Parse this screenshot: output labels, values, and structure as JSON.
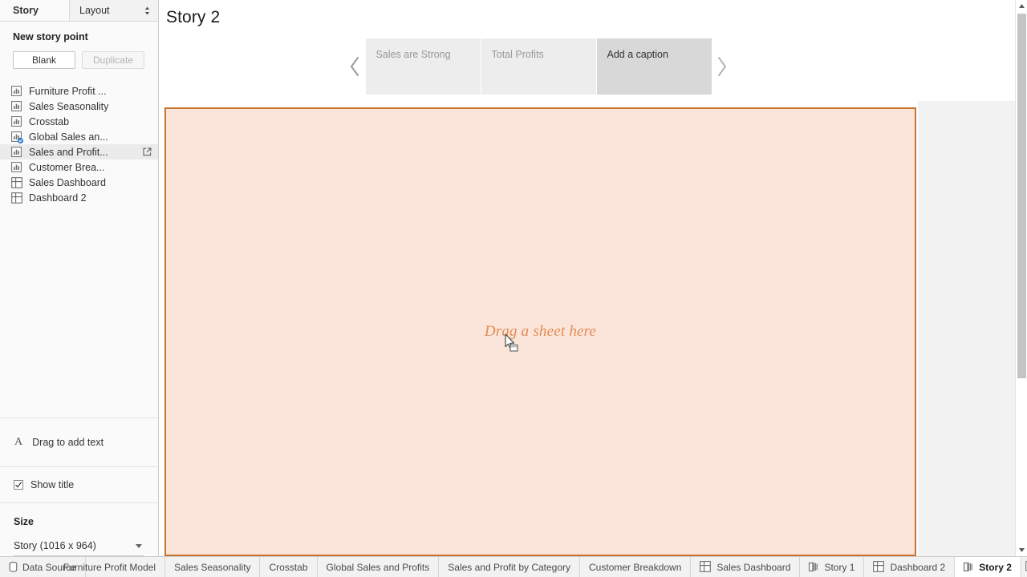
{
  "sidebar": {
    "tabs": [
      {
        "label": "Story",
        "active": true
      },
      {
        "label": "Layout",
        "active": false
      }
    ],
    "new_story_point": {
      "title": "New story point",
      "blank_label": "Blank",
      "duplicate_label": "Duplicate"
    },
    "sheets": [
      {
        "label": "Furniture Profit ...",
        "type": "worksheet",
        "used": false,
        "hovered": false
      },
      {
        "label": "Sales Seasonality",
        "type": "worksheet",
        "used": false,
        "hovered": false
      },
      {
        "label": "Crosstab",
        "type": "worksheet",
        "used": false,
        "hovered": false
      },
      {
        "label": "Global Sales an...",
        "type": "worksheet",
        "used": true,
        "hovered": false
      },
      {
        "label": "Sales and Profit...",
        "type": "worksheet",
        "used": false,
        "hovered": true
      },
      {
        "label": "Customer Brea...",
        "type": "worksheet",
        "used": false,
        "hovered": false
      },
      {
        "label": "Sales Dashboard",
        "type": "dashboard",
        "used": false,
        "hovered": false
      },
      {
        "label": "Dashboard 2",
        "type": "dashboard",
        "used": false,
        "hovered": false
      }
    ],
    "drag_text": {
      "label": "Drag to add text",
      "glyph": "A"
    },
    "show_title": {
      "label": "Show title",
      "checked": true
    },
    "size": {
      "title": "Size",
      "value": "Story (1016 x 964)"
    }
  },
  "main": {
    "story_title": "Story 2",
    "navigator": {
      "prev_icon": "chevron-left-icon",
      "next_icon": "chevron-right-icon",
      "captions": [
        {
          "label": "Sales are Strong",
          "active": false
        },
        {
          "label": "Total Profits",
          "active": false
        },
        {
          "label": "Add a caption",
          "active": true
        }
      ]
    },
    "dropzone": {
      "text": "Drag a sheet here",
      "border_color": "#c8742f",
      "fill_color": "#fbe5da",
      "text_color": "#e08a52"
    }
  },
  "tabbar": {
    "tabs": [
      {
        "label": "Data Source",
        "icon": "database-icon",
        "active": false,
        "clipped": false
      },
      {
        "label": "Furniture Profit Model",
        "icon": "none",
        "active": false,
        "clipped": true
      },
      {
        "label": "Sales Seasonality",
        "icon": "none",
        "active": false,
        "clipped": false
      },
      {
        "label": "Crosstab",
        "icon": "none",
        "active": false,
        "clipped": false
      },
      {
        "label": "Global Sales and Profits",
        "icon": "none",
        "active": false,
        "clipped": false
      },
      {
        "label": "Sales and Profit by Category",
        "icon": "none",
        "active": false,
        "clipped": false
      },
      {
        "label": "Customer Breakdown",
        "icon": "none",
        "active": false,
        "clipped": false
      },
      {
        "label": "Sales Dashboard",
        "icon": "dashboard-icon",
        "active": false,
        "clipped": false
      },
      {
        "label": "Story 1",
        "icon": "story-icon",
        "active": false,
        "clipped": false
      },
      {
        "label": "Dashboard 2",
        "icon": "dashboard-icon",
        "active": false,
        "clipped": false
      },
      {
        "label": "Story 2",
        "icon": "story-icon",
        "active": true,
        "clipped": false
      }
    ],
    "add_buttons": [
      {
        "name": "new-worksheet-button"
      },
      {
        "name": "new-dashboard-button"
      },
      {
        "name": "new-story-button"
      }
    ]
  }
}
